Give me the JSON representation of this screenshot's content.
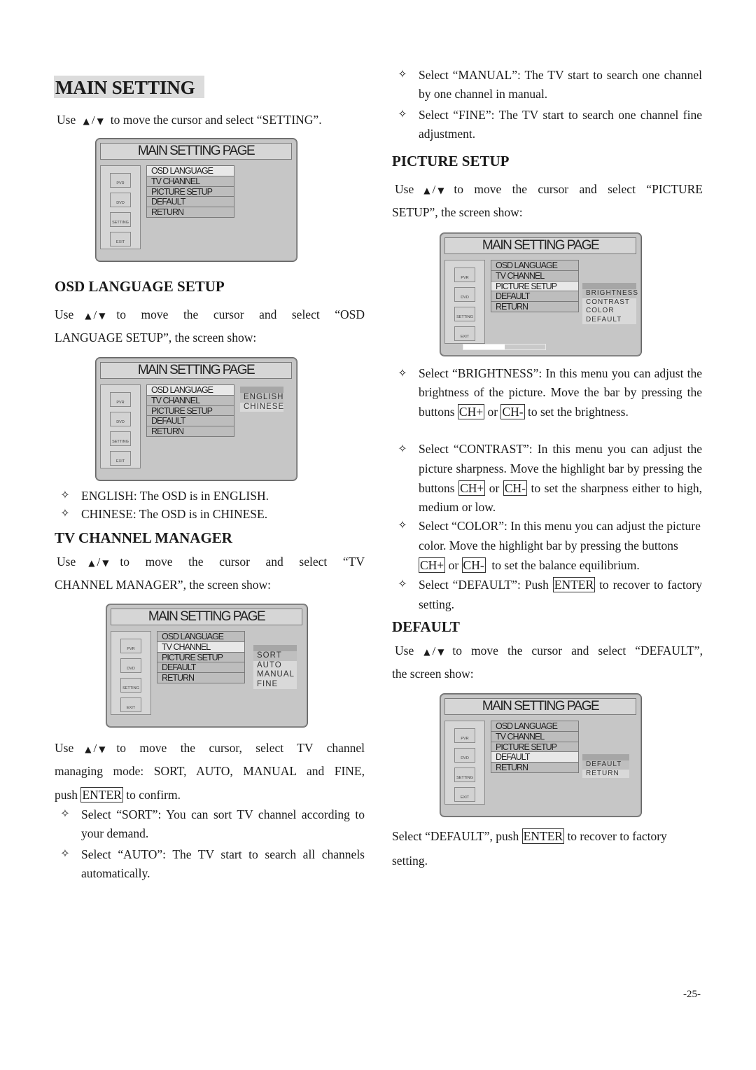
{
  "page": {
    "number": "-25-"
  },
  "arrows": {
    "up": "▲",
    "slash": "/",
    "down": "▼"
  },
  "bullet_glyph": "✧",
  "osd": {
    "title": "MAIN SETTING PAGE",
    "side_buttons": [
      "PVR",
      "DVD",
      "SETTING",
      "EXIT"
    ],
    "menu_items": [
      "OSD LANGUAGE",
      "TV CHANNEL",
      "PICTURE SETUP",
      "DEFAULT",
      "RETURN"
    ]
  },
  "main_setting": {
    "heading": "MAIN SETTING",
    "use": "Use",
    "instruction": "to move the cursor and select “SETTING”."
  },
  "screens": {
    "main": {
      "selected_menu": 0
    },
    "osd_language": {
      "selected_menu": 0,
      "submenu": [
        "ENGLISH",
        "CHINESE"
      ],
      "selected_sub": 0
    },
    "tv_channel": {
      "selected_menu": 1,
      "submenu": [
        "SORT",
        "AUTO",
        "MANUAL",
        "FINE"
      ],
      "selected_sub": 0
    },
    "picture_setup": {
      "selected_menu": 2,
      "submenu": [
        "BRIGHTNESS",
        "CONTRAST",
        "COLOR",
        "DEFAULT"
      ],
      "selected_sub": 0,
      "level_percent": 50
    },
    "default": {
      "selected_menu": 3,
      "submenu": [
        "DEFAULT",
        "RETURN"
      ],
      "selected_sub": 0
    }
  },
  "osd_language_setup": {
    "heading": "OSD LANGUAGE SETUP",
    "use": "Use",
    "instruction_1": "to move the cursor and select “OSD",
    "instruction_2": "LANGUAGE SETUP”, the screen show:",
    "bullets": [
      "ENGLISH: The OSD is in ENGLISH.",
      "CHINESE: The OSD is in CHINESE."
    ]
  },
  "tv_channel_manager": {
    "heading": "TV CHANNEL MANAGER",
    "use": "Use",
    "instruction_1": "to move the cursor and select “TV",
    "instruction_2": "CHANNEL MANAGER”, the screen show:",
    "mode_text_1": "to move the cursor, select TV channel",
    "mode_text_2": "managing mode: SORT, AUTO, MANUAL and FINE,",
    "mode_text_3_pre": "push",
    "mode_text_3_key": "ENTER",
    "mode_text_3_post": "to confirm.",
    "bullets": [
      "Select “SORT”: You can sort TV channel according to your demand.",
      "Select “AUTO”: The TV start to search all channels automatically.",
      "Select “MANUAL”: The TV start to search one channel by one channel in manual.",
      "Select “FINE”: The TV start to search one channel fine adjustment."
    ]
  },
  "picture_setup": {
    "heading": "PICTURE SETUP",
    "use": "Use",
    "instruction_1": "to move the cursor and select “PICTURE",
    "instruction_2": "SETUP”, the screen show:",
    "brightness": {
      "pre": "Select “BRIGHTNESS”: In this menu you can adjust the brightness of the picture. Move the bar by pressing the buttons",
      "key1": "CH+",
      "mid": "or",
      "key2": "CH-",
      "post": "to set the brightness."
    },
    "contrast": {
      "pre": "Select “CONTRAST”: In this menu you can adjust the picture sharpness. Move the highlight bar by pressing the buttons",
      "key1": "CH+",
      "mid": "or",
      "key2": "CH-",
      "post": "to set the sharpness either to high, medium or low."
    },
    "color": {
      "pre": "Select “COLOR”: In this menu you can adjust the picture color. Move the highlight bar by pressing the buttons",
      "key1": "CH+",
      "mid": "or",
      "key2": "CH-",
      "post": "to set the balance equilibrium."
    },
    "default": {
      "pre": "Select “DEFAULT”: Push",
      "key": "ENTER",
      "post": "to recover to factory setting."
    }
  },
  "default_section": {
    "heading": "DEFAULT",
    "use": "Use",
    "instruction_1": "to move the cursor and select “DEFAULT”,",
    "instruction_2": "the screen show:",
    "final_pre": "Select “DEFAULT”, push",
    "final_key": "ENTER",
    "final_post": "to recover to factory",
    "final_line2": "setting."
  }
}
